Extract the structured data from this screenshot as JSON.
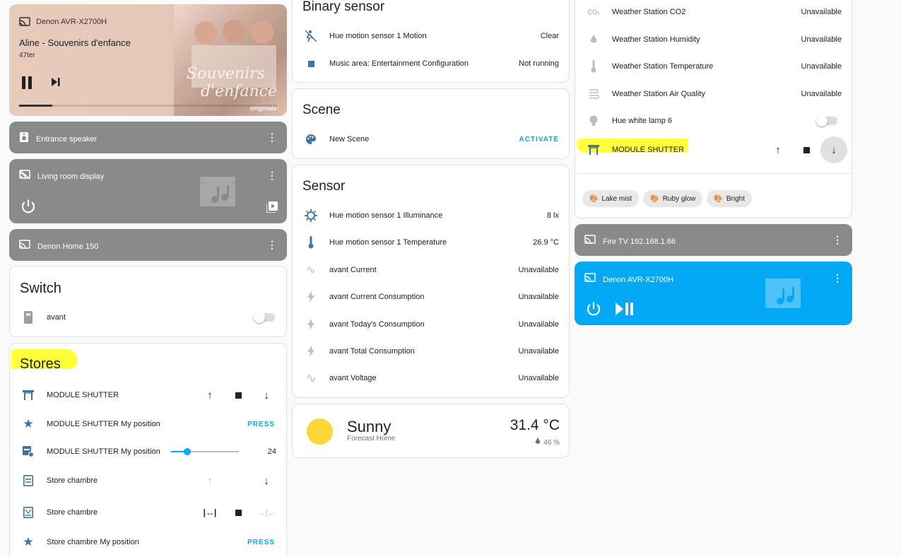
{
  "media_main": {
    "device": "Denon AVR-X2700H",
    "title": "Aline - Souvenirs d'enfance",
    "artist": "47ter",
    "progress": 0.13
  },
  "speakers": [
    {
      "name": "Entrance speaker"
    },
    {
      "name": "Living room display"
    },
    {
      "name": "Denon Home 150"
    }
  ],
  "switch": {
    "title": "Switch",
    "items": [
      {
        "name": "avant",
        "state": "off"
      }
    ]
  },
  "stores": {
    "title": "Stores",
    "items": [
      {
        "name": "MODULE SHUTTER"
      },
      {
        "name": "MODULE SHUTTER My position",
        "action": "PRESS"
      },
      {
        "name": "MODULE SHUTTER My position",
        "value": "24",
        "level": 0.24
      },
      {
        "name": "Store chambre"
      },
      {
        "name": "Store chambre"
      },
      {
        "name": "Store chambre My position",
        "action": "PRESS"
      }
    ]
  },
  "binary_sensor": {
    "title": "Binary sensor",
    "items": [
      {
        "name": "Hue motion sensor 1 Motion",
        "state": "Clear"
      },
      {
        "name": "Music area: Entertainment Configuration",
        "state": "Not running"
      }
    ]
  },
  "scene": {
    "title": "Scene",
    "items": [
      {
        "name": "New Scene",
        "action": "ACTIVATE"
      }
    ]
  },
  "sensor": {
    "title": "Sensor",
    "items": [
      {
        "name": "Hue motion sensor 1 Illuminance",
        "state": "8 lx"
      },
      {
        "name": "Hue motion sensor 1 Temperature",
        "state": "26.9 °C"
      },
      {
        "name": "avant Current",
        "state": "Unavailable"
      },
      {
        "name": "avant Current Consumption",
        "state": "Unavailable"
      },
      {
        "name": "avant Today's Consumption",
        "state": "Unavailable"
      },
      {
        "name": "avant Total Consumption",
        "state": "Unavailable"
      },
      {
        "name": "avant Voltage",
        "state": "Unavailable"
      }
    ]
  },
  "weather": {
    "condition": "Sunny",
    "source": "Forecast Home",
    "temperature": "31.4 °C",
    "humidity": "46 %"
  },
  "right_entities": {
    "items": [
      {
        "name": "Weather Station CO2",
        "state": "Unavailable",
        "icon_text": "CO₂"
      },
      {
        "name": "Weather Station Humidity",
        "state": "Unavailable"
      },
      {
        "name": "Weather Station Temperature",
        "state": "Unavailable"
      },
      {
        "name": "Weather Station Air Quality",
        "state": "Unavailable"
      },
      {
        "name": "Hue white lamp 6",
        "state": "off"
      },
      {
        "name": "MODULE SHUTTER"
      }
    ],
    "chips": [
      "Lake mist",
      "Ruby glow",
      "Bright"
    ]
  },
  "media_right": [
    {
      "name": "Fire TV 192.168.1.66"
    },
    {
      "name": "Denon AVR-X2700H"
    }
  ],
  "colors": {
    "accent": "#03a9f4",
    "icon": "#44739e",
    "grey_card": "#8a8a8a",
    "highlight": "#ffff3a"
  }
}
